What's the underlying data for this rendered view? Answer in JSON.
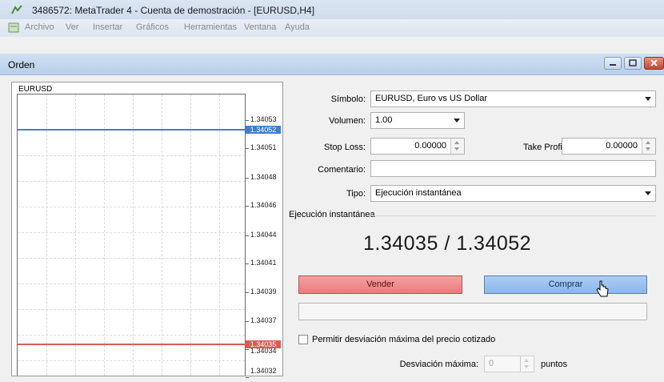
{
  "window": {
    "title": "3486572: MetaTrader 4 - Cuenta de demostración - [EURUSD,H4]"
  },
  "menu": [
    "Archivo",
    "Ver",
    "Insertar",
    "Gráficos",
    "Herramientas",
    "Ventana",
    "Ayuda"
  ],
  "dialog": {
    "title": "Orden"
  },
  "chart": {
    "symbol": "EURUSD",
    "price_labels": [
      "1.34053",
      "1.34051",
      "1.34048",
      "1.34046",
      "1.34044",
      "1.34041",
      "1.34039",
      "1.34037",
      "1.34034",
      "1.34032"
    ],
    "ask_tag": "1.34052",
    "bid_tag": "1.34035"
  },
  "form": {
    "symbol_label": "Símbolo:",
    "symbol_value": "EURUSD, Euro vs US Dollar",
    "volume_label": "Volumen:",
    "volume_value": "1.00",
    "stoploss_label": "Stop Loss:",
    "stoploss_value": "0.00000",
    "takeprofit_label": "Take Profit:",
    "takeprofit_value": "0.00000",
    "comment_label": "Comentario:",
    "comment_value": "",
    "type_label": "Tipo:",
    "type_value": "Ejecución instantánea"
  },
  "execution": {
    "group_label": "Ejecución instantánea",
    "quote": "1.34035 / 1.34052",
    "sell_label": "Vender",
    "buy_label": "Comprar",
    "deviation_checkbox_label": "Permitir desviación máxima del precio cotizado",
    "max_deviation_label": "Desviación máxima:",
    "max_deviation_value": "0",
    "points_label": "puntos"
  },
  "colors": {
    "sell": "#ea7c7c",
    "buy": "#8cb7ea",
    "ask_line": "#3f7fd0",
    "bid_line": "#e05a5a"
  }
}
